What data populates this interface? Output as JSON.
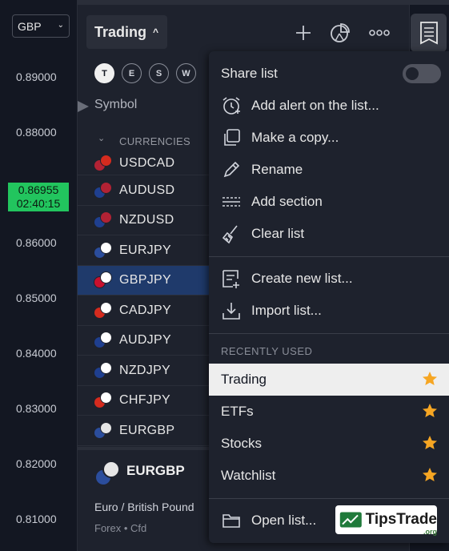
{
  "price_axis": {
    "currency": "GBP",
    "labels": [
      "0.89000",
      "0.88000",
      "0.86000",
      "0.85000",
      "0.84000",
      "0.83000",
      "0.82000",
      "0.81000"
    ],
    "current_price": "0.86955",
    "countdown": "02:40:15",
    "current_price_color": "#22c55e"
  },
  "header": {
    "watchlist_name": "Trading",
    "icons": [
      "plus-icon",
      "pie-chart-icon",
      "more-icon",
      "watchlist-icon"
    ]
  },
  "filters": [
    "T",
    "E",
    "S",
    "W"
  ],
  "table": {
    "column_header": "Symbol",
    "section": "CURRENCIES",
    "rows": [
      {
        "symbol": "USDCAD",
        "a": "#b22234",
        "b": "#d52b1e"
      },
      {
        "symbol": "AUDUSD",
        "a": "#1f3f8f",
        "b": "#b22234"
      },
      {
        "symbol": "NZDUSD",
        "a": "#1f3f8f",
        "b": "#b22234"
      },
      {
        "symbol": "EURJPY",
        "a": "#2b4d9c",
        "b": "#ffffff"
      },
      {
        "symbol": "GBPJPY",
        "a": "#c8102e",
        "b": "#ffffff"
      },
      {
        "symbol": "CADJPY",
        "a": "#d52b1e",
        "b": "#ffffff"
      },
      {
        "symbol": "AUDJPY",
        "a": "#1f3f8f",
        "b": "#ffffff"
      },
      {
        "symbol": "NZDJPY",
        "a": "#1f3f8f",
        "b": "#ffffff"
      },
      {
        "symbol": "CHFJPY",
        "a": "#d52b1e",
        "b": "#ffffff"
      },
      {
        "symbol": "EURGBP",
        "a": "#2b4d9c",
        "b": "#e6e6e6"
      }
    ],
    "selected_symbol": "GBPJPY"
  },
  "detail": {
    "symbol": "EURGBP",
    "name": "Euro / British Pound",
    "type": "Forex • Cfd"
  },
  "menu": {
    "share": "Share list",
    "share_enabled": false,
    "actions": [
      {
        "label": "Add alert on the list...",
        "icon": "alarm-clock-icon"
      },
      {
        "label": "Make a copy...",
        "icon": "copy-icon"
      },
      {
        "label": "Rename",
        "icon": "pencil-icon"
      },
      {
        "label": "Add section",
        "icon": "section-icon"
      },
      {
        "label": "Clear list",
        "icon": "broom-icon"
      },
      {
        "label": "Create new list...",
        "icon": "new-list-icon"
      },
      {
        "label": "Import list...",
        "icon": "import-icon"
      }
    ],
    "recent_header": "RECENTLY USED",
    "recent": [
      {
        "label": "Trading",
        "starred": true,
        "active": true
      },
      {
        "label": "ETFs",
        "starred": true,
        "active": false
      },
      {
        "label": "Stocks",
        "starred": true,
        "active": false
      },
      {
        "label": "Watchlist",
        "starred": true,
        "active": false
      }
    ],
    "open_list": "Open list...",
    "star_color": "#f6a623"
  },
  "watermark": {
    "brand": "TipsTrade",
    "suffix": ".org"
  }
}
